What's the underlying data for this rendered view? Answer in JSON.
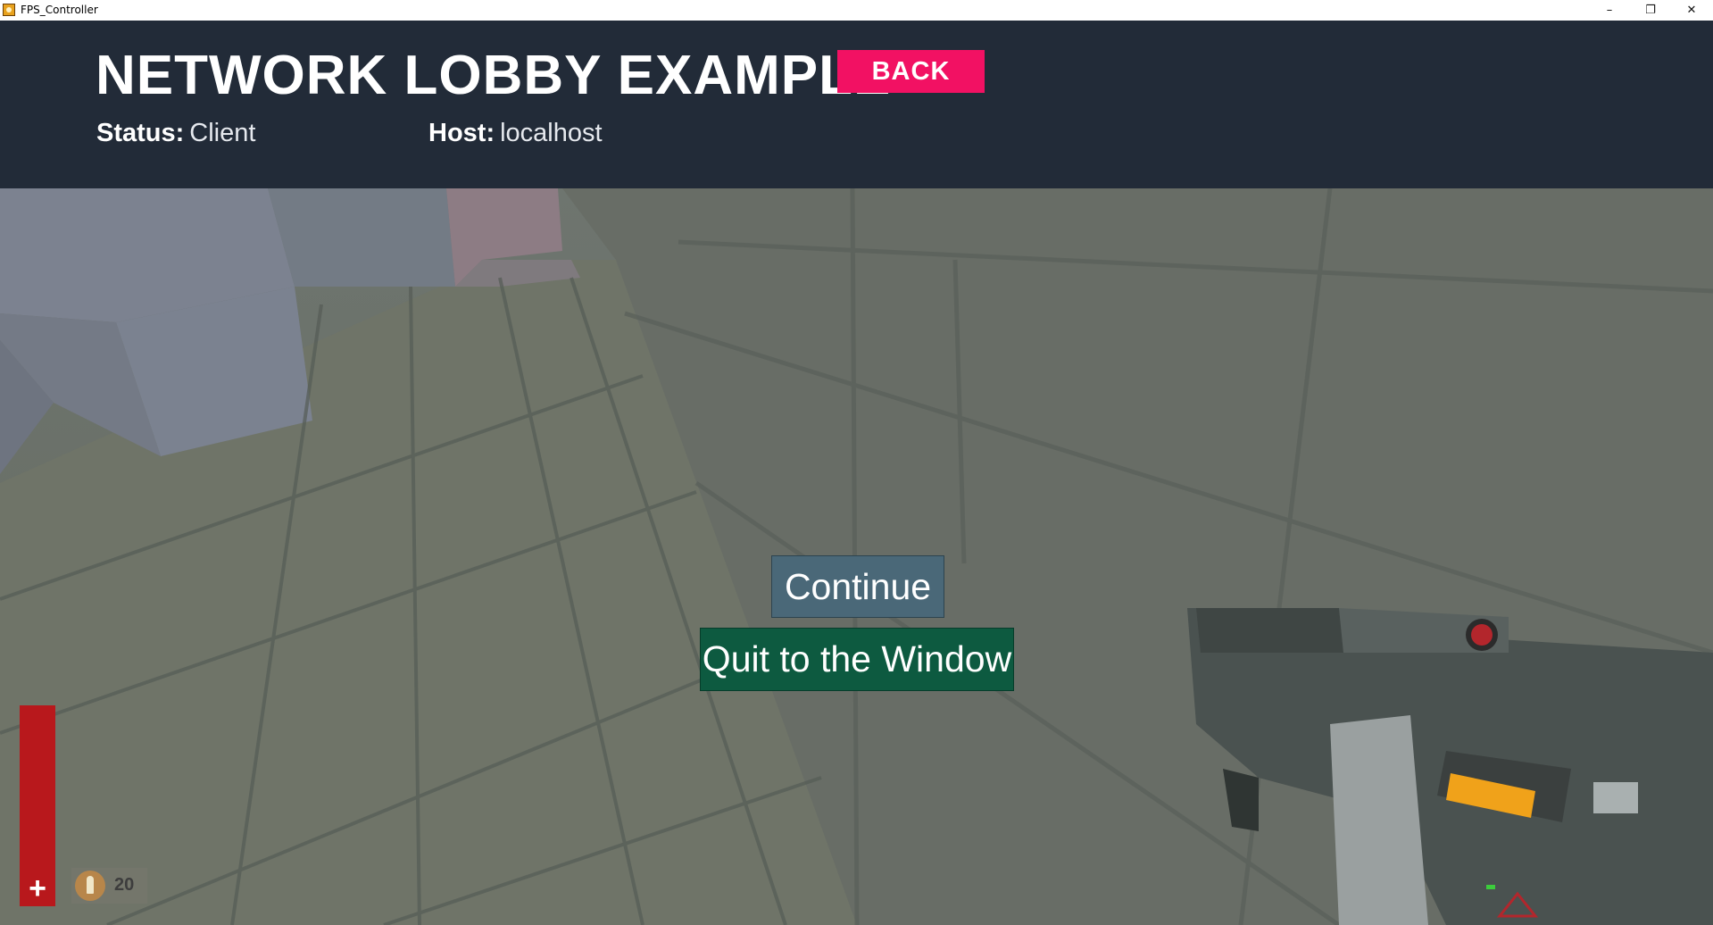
{
  "window": {
    "title": "FPS_Controller",
    "controls": {
      "minimize": "–",
      "maximize": "❐",
      "close": "✕"
    }
  },
  "lobby": {
    "title": "NETWORK LOBBY EXAMPLE",
    "back_label": "BACK",
    "status_label": "Status:",
    "status_value": "Client",
    "host_label": "Host:",
    "host_value": "localhost"
  },
  "pause_menu": {
    "continue_label": "Continue",
    "quit_label": "Quit to the Window"
  },
  "hud": {
    "health_fraction": 1.0,
    "health_icon": "+",
    "ammo_icon": "bullet-icon",
    "ammo_count": "20"
  },
  "colors": {
    "header_bg": "#222b38",
    "back_button": "#f21163",
    "continue_button": "#4a6878",
    "quit_button": "#0d5a40",
    "health": "#b8181c"
  }
}
